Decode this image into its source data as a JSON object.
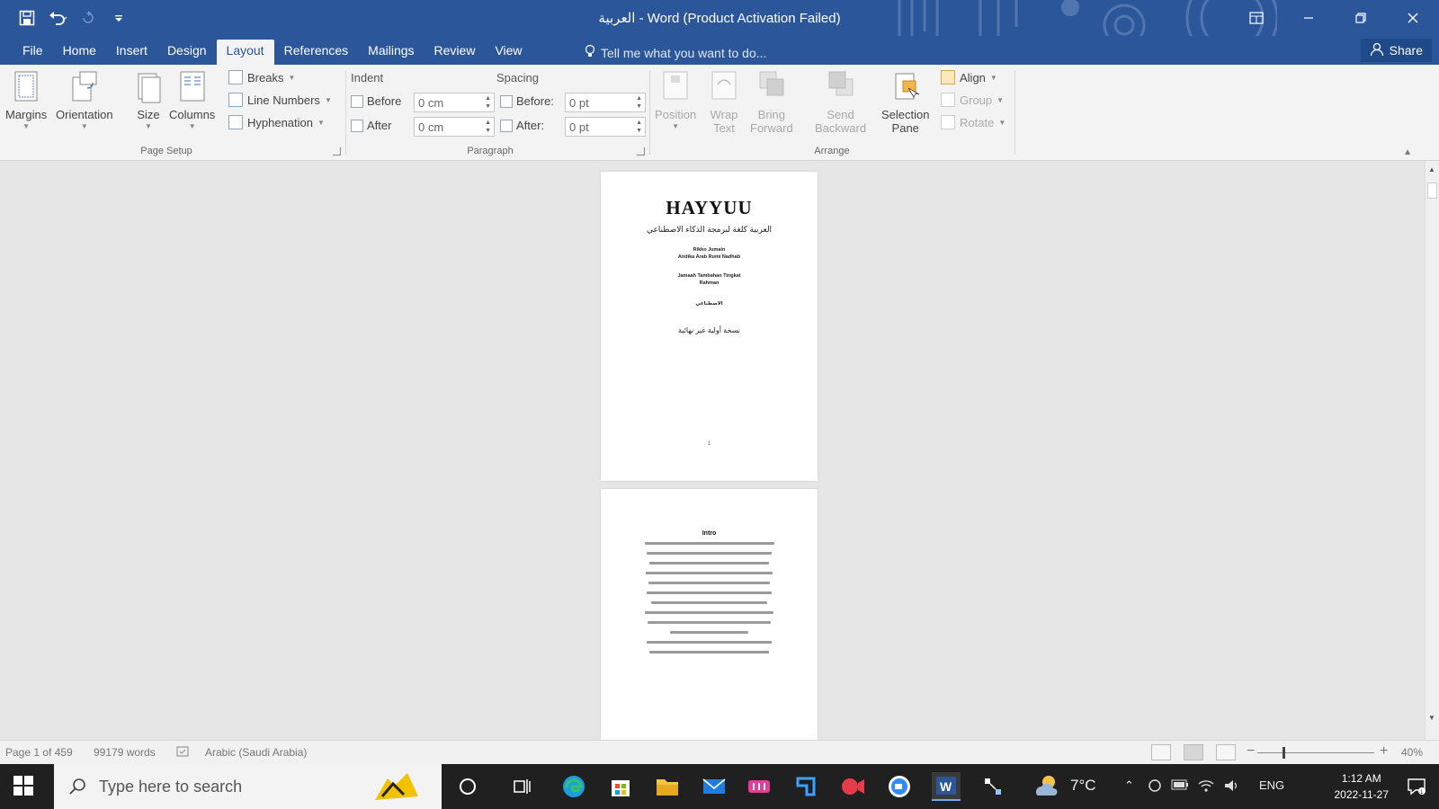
{
  "window": {
    "title": "العربية - Word (Product Activation Failed)"
  },
  "tabs": [
    {
      "label": "File"
    },
    {
      "label": "Home"
    },
    {
      "label": "Insert"
    },
    {
      "label": "Design"
    },
    {
      "label": "Layout",
      "active": true
    },
    {
      "label": "References"
    },
    {
      "label": "Mailings"
    },
    {
      "label": "Review"
    },
    {
      "label": "View"
    }
  ],
  "tellme": "Tell me what you want to do...",
  "share": "Share",
  "ribbon": {
    "page_setup": {
      "label": "Page Setup",
      "margins": "Margins",
      "orientation": "Orientation",
      "size": "Size",
      "columns": "Columns",
      "breaks": "Breaks",
      "line_numbers": "Line Numbers",
      "hyphenation": "Hyphenation"
    },
    "paragraph": {
      "label": "Paragraph",
      "indent": "Indent",
      "spacing": "Spacing",
      "indent_before_label": "Before",
      "indent_after_label": "After",
      "indent_before_value": "0 cm",
      "indent_after_value": "0 cm",
      "spacing_before_label": "Before:",
      "spacing_after_label": "After:",
      "spacing_before_value": "0 pt",
      "spacing_after_value": "0 pt"
    },
    "arrange": {
      "label": "Arrange",
      "position": "Position",
      "wrap_text_1": "Wrap",
      "wrap_text_2": "Text",
      "bring_forward_1": "Bring",
      "bring_forward_2": "Forward",
      "send_backward_1": "Send",
      "send_backward_2": "Backward",
      "selection_pane_1": "Selection",
      "selection_pane_2": "Pane",
      "align": "Align",
      "group": "Group",
      "rotate": "Rotate"
    }
  },
  "document": {
    "page1": {
      "title": "HAYYUU",
      "subtitle": "العربية كلغة لبرمجة الذكاء الاصطناعي",
      "block1": [
        "Rikko Jumain",
        "Andika Arab Rumi Nadhab"
      ],
      "block2": [
        "Jamaah Tambahan Tingkat",
        "Rahman"
      ],
      "block3": "الاصطناعي",
      "arabic_line": "نسخة أولية غير نهائية",
      "page_number": "1"
    },
    "page2": {
      "heading": "Intro",
      "line_count": 12
    }
  },
  "statusbar": {
    "page": "Page 1 of 459",
    "words": "99179 words",
    "language": "Arabic (Saudi Arabia)",
    "zoom": "40%"
  },
  "taskbar": {
    "search_placeholder": "Type here to search",
    "weather": "7°C",
    "lang": "ENG",
    "time": "1:12 AM",
    "date": "2022-11-27"
  },
  "colors": {
    "word_blue": "#2b579a",
    "ribbon_bg": "#f3f3f3",
    "doc_bg": "#e6e6e6",
    "taskbar_bg": "#202020"
  }
}
